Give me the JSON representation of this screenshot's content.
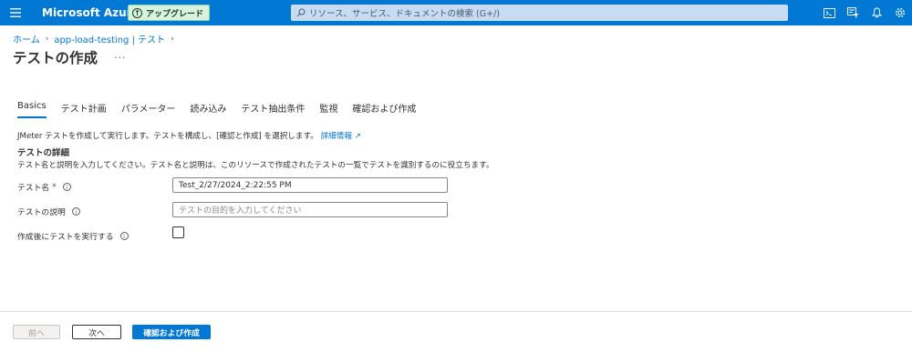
{
  "header": {
    "brand": "Microsoft Azure",
    "upgrade_label": "アップグレード",
    "search_placeholder": "リソース、サービス、ドキュメントの検索 (G+/)",
    "icons": [
      "menu-icon",
      "cloud-shell-icon",
      "directory-filter-icon",
      "notifications-icon",
      "settings-icon"
    ]
  },
  "breadcrumb": {
    "items": [
      "ホーム",
      "app-load-testing | テスト"
    ]
  },
  "page": {
    "title": "テストの作成",
    "more": "···"
  },
  "tabs": [
    {
      "label": "Basics",
      "active": true
    },
    {
      "label": "テスト計画",
      "active": false
    },
    {
      "label": "パラメーター",
      "active": false
    },
    {
      "label": "読み込み",
      "active": false
    },
    {
      "label": "テスト抽出条件",
      "active": false
    },
    {
      "label": "監視",
      "active": false
    },
    {
      "label": "確認および作成",
      "active": false
    }
  ],
  "intro": {
    "text": "JMeter テストを作成して実行します。テストを構成し、[確認と作成] を選択します。",
    "link": "詳細情報"
  },
  "section": {
    "title": "テストの詳細",
    "description": "テスト名と説明を入力してください。テスト名と説明は、このリソースで作成されたテストの一覧でテストを識別するのに役立ちます。"
  },
  "form": {
    "test_name_label": "テスト名",
    "required_mark": "*",
    "test_name_value": "Test_2/27/2024_2:22:55 PM",
    "description_label": "テストの説明",
    "description_placeholder": "テストの目的を入力してください",
    "run_after_create_label": "作成後にテストを実行する",
    "run_after_create_checked": false
  },
  "footer": {
    "prev_label": "前へ",
    "next_label": "次へ",
    "review_label": "確認および作成"
  },
  "colors": {
    "accent": "#0078d4",
    "upgrade_bg": "#d7f2dd",
    "required": "#a4262c"
  }
}
